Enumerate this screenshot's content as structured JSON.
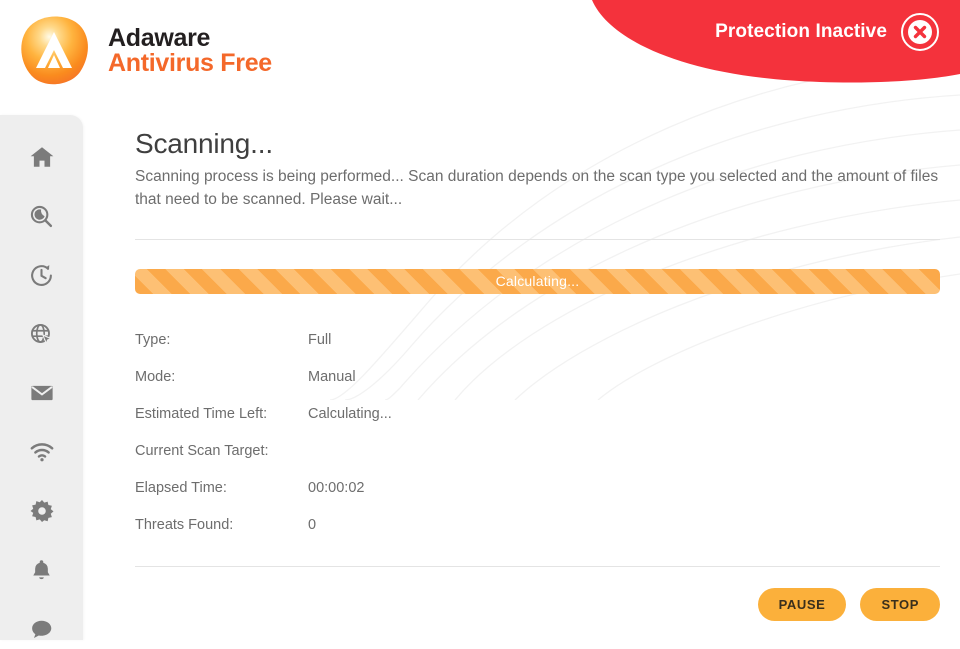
{
  "app": {
    "brand_name": "Adaware",
    "brand_product": "Antivirus Free",
    "logo_icon": "adaware-logo-icon",
    "accent_orange": "#f4682a",
    "banner_red": "#f4323c",
    "progress_orange": "#fba94a",
    "button_orange": "#fbb03b"
  },
  "banner": {
    "status_text": "Protection Inactive",
    "status_icon": "close-circle-icon"
  },
  "sidebar": {
    "items": [
      {
        "name": "home",
        "icon": "home-icon"
      },
      {
        "name": "scan",
        "icon": "scan-search-icon"
      },
      {
        "name": "history",
        "icon": "clock-history-icon"
      },
      {
        "name": "web-protection",
        "icon": "globe-cursor-icon"
      },
      {
        "name": "email-protection",
        "icon": "mail-icon"
      },
      {
        "name": "network",
        "icon": "wifi-icon"
      },
      {
        "name": "settings",
        "icon": "gear-icon"
      },
      {
        "name": "notifications",
        "icon": "bell-icon"
      },
      {
        "name": "support-chat",
        "icon": "chat-bubble-icon"
      }
    ]
  },
  "main": {
    "title": "Scanning...",
    "description": "Scanning process is being performed... Scan duration depends on the scan type you selected and the amount of files that need to be scanned. Please wait..."
  },
  "progress": {
    "label": "Calculating...",
    "percent": 0,
    "indeterminate": true
  },
  "details": {
    "rows": [
      {
        "label": "Type:",
        "value": "Full"
      },
      {
        "label": "Mode:",
        "value": "Manual"
      },
      {
        "label": "Estimated Time Left:",
        "value": "Calculating..."
      },
      {
        "label": "Current Scan Target:",
        "value": ""
      },
      {
        "label": "Elapsed Time:",
        "value": "00:00:02"
      },
      {
        "label": "Threats Found:",
        "value": "0"
      }
    ]
  },
  "actions": {
    "pause_label": "PAUSE",
    "stop_label": "STOP"
  }
}
